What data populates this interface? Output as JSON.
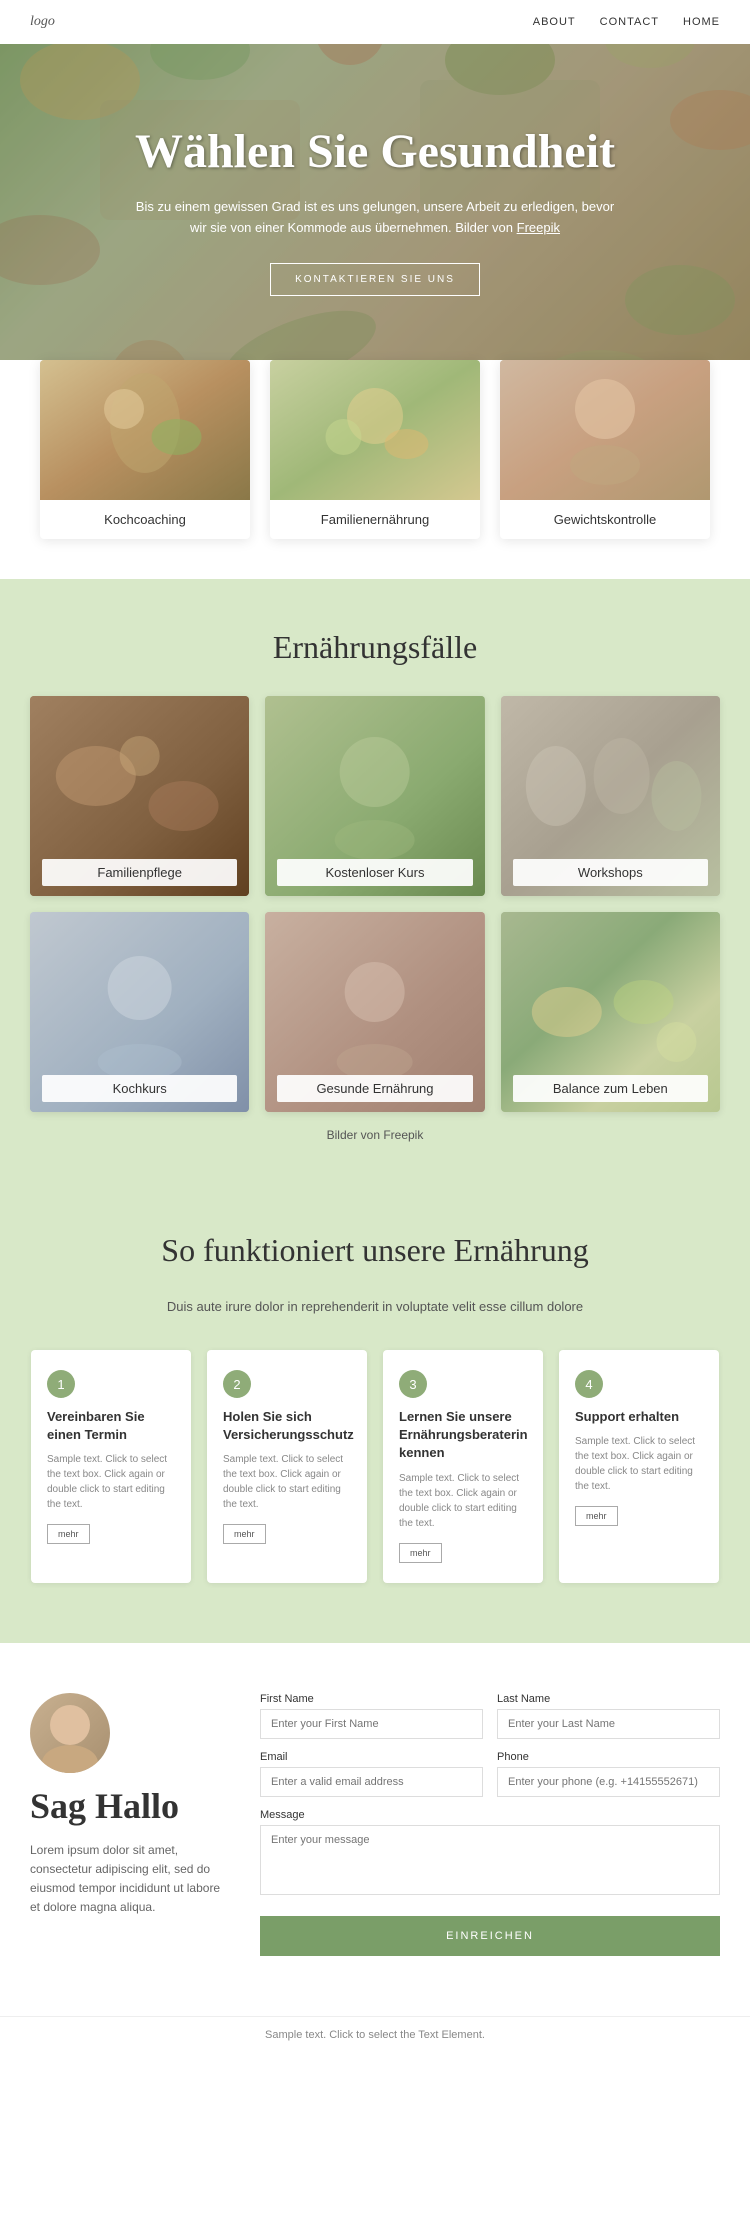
{
  "nav": {
    "logo": "logo",
    "links": [
      "ABOUT",
      "CONTACT",
      "HOME"
    ]
  },
  "hero": {
    "title": "Wählen Sie Gesundheit",
    "subtitle": "Bis zu einem gewissen Grad ist es uns gelungen, unsere Arbeit zu erledigen, bevor wir sie von einer Kommode aus übernehmen. Bilder von Freepik",
    "freepik_text": "Freepik",
    "btn_label": "KONTAKTIEREN SIE UNS"
  },
  "service_cards": [
    {
      "label": "Kochcoaching"
    },
    {
      "label": "Familienernährung"
    },
    {
      "label": "Gewichtskontrolle"
    }
  ],
  "nutrition_section": {
    "title": "Ernährungsfälle",
    "grid_items": [
      {
        "label": "Familienpflege"
      },
      {
        "label": "Kostenloser Kurs"
      },
      {
        "label": "Workshops"
      },
      {
        "label": "Kochkurs"
      },
      {
        "label": "Gesunde Ernährung"
      },
      {
        "label": "Balance zum Leben"
      }
    ],
    "credit": "Bilder von Freepik"
  },
  "how_section": {
    "title": "So funktioniert unsere Ernährung",
    "subtitle": "Duis aute irure dolor in reprehenderit in voluptate velit esse cillum dolore",
    "steps": [
      {
        "num": "1",
        "title": "Vereinbaren Sie einen Termin",
        "text": "Sample text. Click to select the text box. Click again or double click to start editing the text.",
        "btn": "mehr"
      },
      {
        "num": "2",
        "title": "Holen Sie sich Versicherungsschutz",
        "text": "Sample text. Click to select the text box. Click again or double click to start editing the text.",
        "btn": "mehr"
      },
      {
        "num": "3",
        "title": "Lernen Sie unsere Ernährungsberaterin kennen",
        "text": "Sample text. Click to select the text box. Click again or double click to start editing the text.",
        "btn": "mehr"
      },
      {
        "num": "4",
        "title": "Support erhalten",
        "text": "Sample text. Click to select the text box. Click again or double click to start editing the text.",
        "btn": "mehr"
      }
    ]
  },
  "contact_section": {
    "heading": "Sag Hallo",
    "text": "Lorem ipsum dolor sit amet, consectetur adipiscing elit, sed do eiusmod tempor incididunt ut labore et dolore magna aliqua.",
    "form": {
      "first_name_label": "First Name",
      "first_name_placeholder": "Enter your First Name",
      "last_name_label": "Last Name",
      "last_name_placeholder": "Enter your Last Name",
      "email_label": "Email",
      "email_placeholder": "Enter a valid email address",
      "phone_label": "Phone",
      "phone_placeholder": "Enter your phone (e.g. +14155552671)",
      "message_label": "Message",
      "message_placeholder": "Enter your message",
      "submit_label": "EINREICHEN"
    }
  },
  "footer": {
    "note": "Sample text. Click to select the Text Element."
  }
}
